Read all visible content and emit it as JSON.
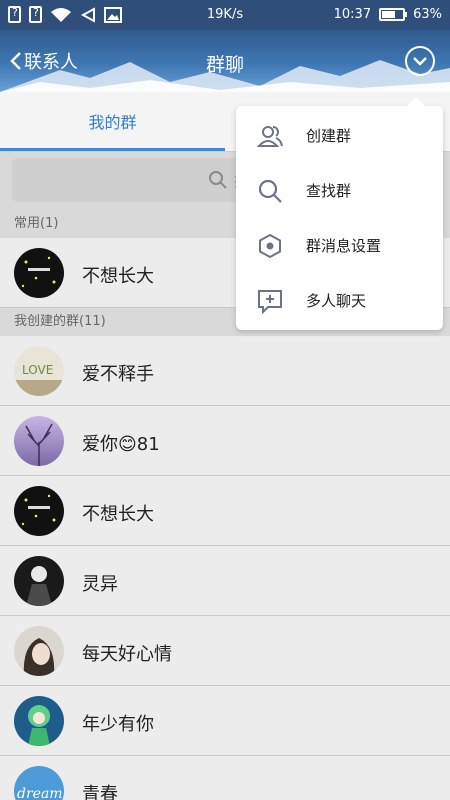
{
  "status_bar": {
    "sim1": "?",
    "sim2": "?",
    "speed": "19K/s",
    "time": "10:37",
    "battery_percent": "63%",
    "battery_level": 0.63
  },
  "header": {
    "back_label": "联系人",
    "title": "群聊"
  },
  "tabs": [
    {
      "label": "我的群",
      "active": true
    }
  ],
  "search": {
    "placeholder": "搜"
  },
  "sections": {
    "frequent": "常用(1)",
    "created": "我创建的群(11)"
  },
  "frequent_groups": [
    {
      "name": "不想长大",
      "avatar": "stars"
    }
  ],
  "created_groups": [
    {
      "name": "爱不释手",
      "avatar": "love"
    },
    {
      "name": "爱你😊81",
      "avatar": "purple-tree"
    },
    {
      "name": "不想长大",
      "avatar": "stars"
    },
    {
      "name": "灵异",
      "avatar": "dark-figure"
    },
    {
      "name": "每天好心情",
      "avatar": "girl-portrait"
    },
    {
      "name": "年少有你",
      "avatar": "green-anime"
    },
    {
      "name": "青春",
      "avatar": "dream-blue"
    }
  ],
  "menu": {
    "items": [
      {
        "label": "创建群",
        "icon": "users-icon"
      },
      {
        "label": "查找群",
        "icon": "search-icon"
      },
      {
        "label": "群消息设置",
        "icon": "hexagon-settings-icon"
      },
      {
        "label": "多人聊天",
        "icon": "chat-plus-icon"
      }
    ]
  },
  "colors": {
    "header_dark": "#2f5a8c",
    "accent_blue": "#2e7fd6",
    "list_bg": "#ececec",
    "page_bg": "#d9d9d9"
  }
}
